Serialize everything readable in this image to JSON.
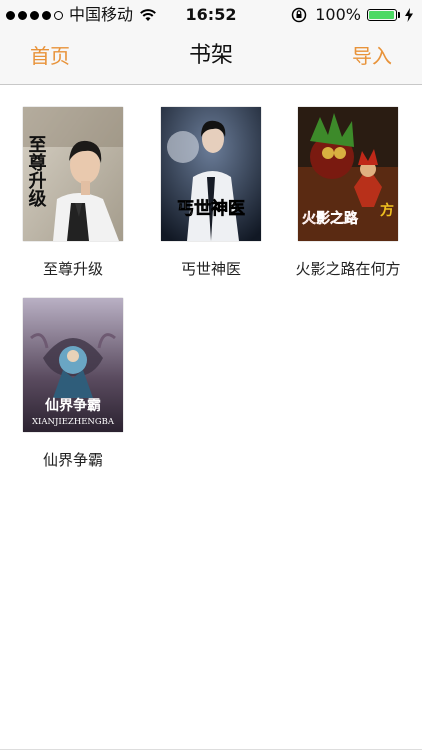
{
  "status_bar": {
    "carrier": "中国移动",
    "time": "16:52",
    "battery": "100%",
    "battery_level": 1.0
  },
  "nav": {
    "left": "首页",
    "title": "书架",
    "right": "导入"
  },
  "books": [
    {
      "title": "至尊升级"
    },
    {
      "title": "丐世神医"
    },
    {
      "title": "火影之路在何方"
    },
    {
      "title": "仙界争霸"
    }
  ],
  "covers": {
    "book1_text": "至尊升级",
    "book2_text": "丐世神医",
    "book3_text": "火影之路",
    "book3_side": "方",
    "book4_text": "仙界争霸",
    "book4_sub": "XIANJIEZHENGBA"
  },
  "colors": {
    "accent": "#e8933a",
    "battery": "#4cd964"
  },
  "icons": [
    "signal-dots-icon",
    "wifi-icon",
    "rotation-lock-icon",
    "battery-icon",
    "charging-bolt-icon"
  ]
}
